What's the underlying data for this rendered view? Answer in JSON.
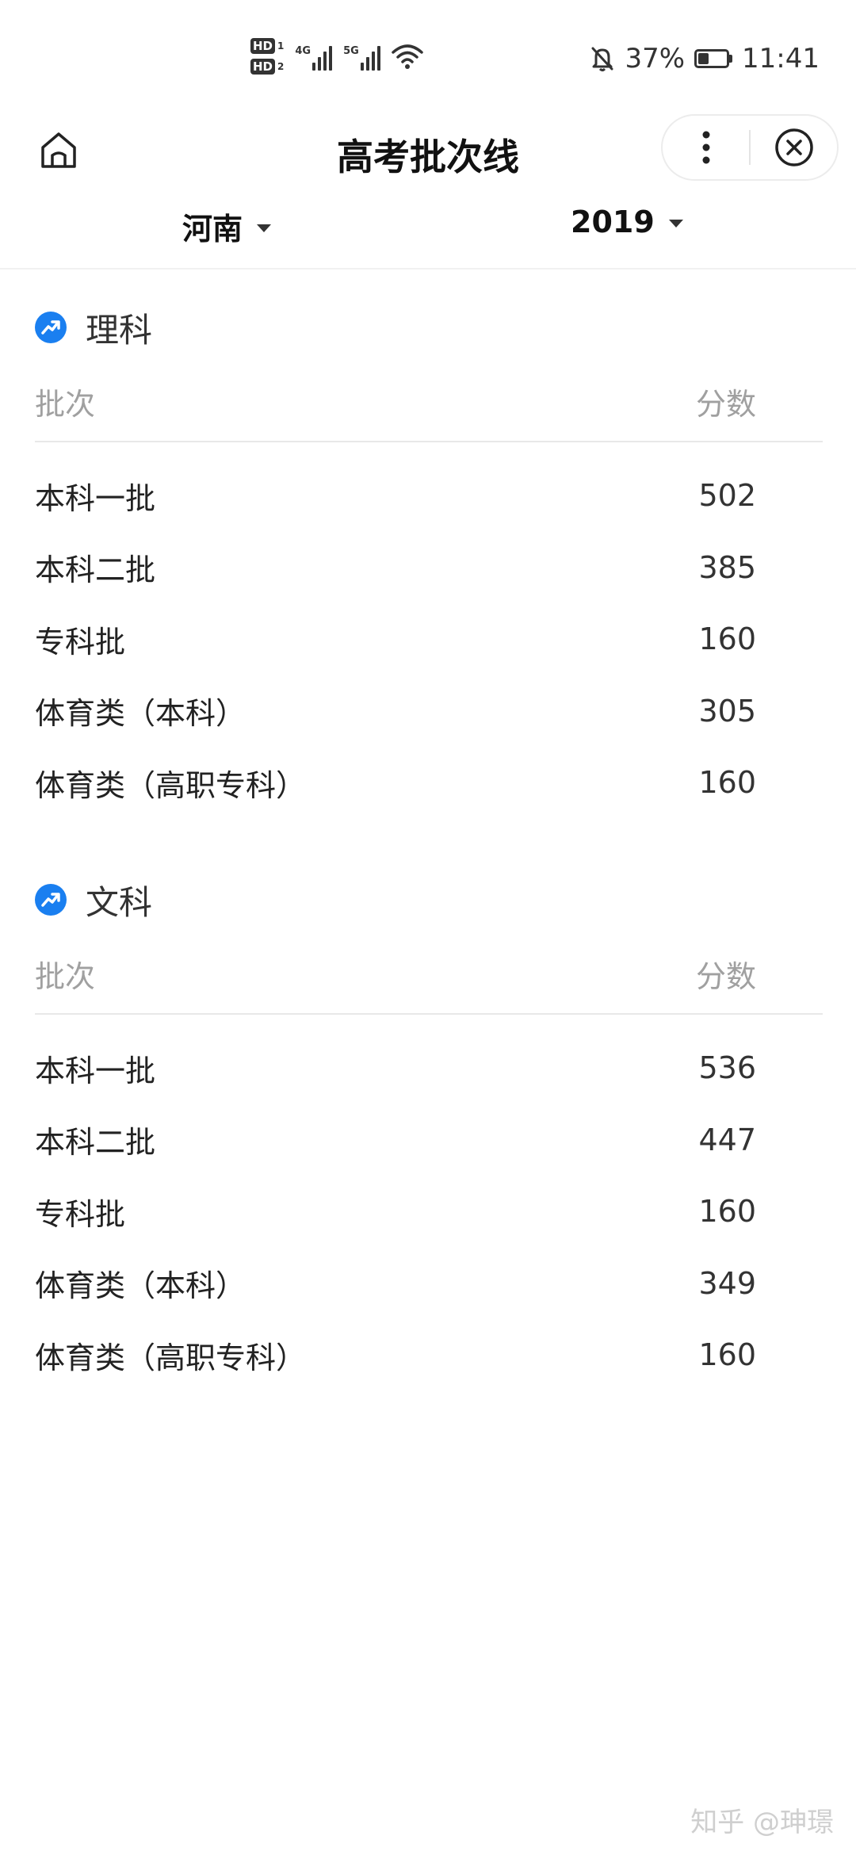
{
  "status_bar": {
    "hd_badges": [
      {
        "label": "HD",
        "slot": "1"
      },
      {
        "label": "HD",
        "slot": "2"
      }
    ],
    "network_1": "4G",
    "network_2": "5G",
    "signal_icon": "signal-bars-icon",
    "wifi_icon": "wifi-icon",
    "mute_icon": "bell-off-icon",
    "battery_percent": "37%",
    "battery_level": 0.37,
    "time": "11:41"
  },
  "title_bar": {
    "title": "高考批次线",
    "home_icon": "home-icon",
    "more_icon": "more-vertical-icon",
    "close_icon": "close-circle-icon"
  },
  "filters": {
    "province": "河南",
    "year": "2019"
  },
  "sections": [
    {
      "title": "理科",
      "icon": "trend-up-icon",
      "col_batch": "批次",
      "col_score": "分数",
      "rows": [
        {
          "batch": "本科一批",
          "score": "502"
        },
        {
          "batch": "本科二批",
          "score": "385"
        },
        {
          "batch": "专科批",
          "score": "160"
        },
        {
          "batch": "体育类（本科）",
          "score": "305"
        },
        {
          "batch": "体育类（高职专科）",
          "score": "160"
        }
      ]
    },
    {
      "title": "文科",
      "icon": "trend-up-icon",
      "col_batch": "批次",
      "col_score": "分数",
      "rows": [
        {
          "batch": "本科一批",
          "score": "536"
        },
        {
          "batch": "本科二批",
          "score": "447"
        },
        {
          "batch": "专科批",
          "score": "160"
        },
        {
          "batch": "体育类（本科）",
          "score": "349"
        },
        {
          "batch": "体育类（高职专科）",
          "score": "160"
        }
      ]
    }
  ],
  "watermark": "知乎 @珅璟",
  "colors": {
    "accent": "#1a7ff0",
    "text": "#222222",
    "muted": "#a0a0a0",
    "divider": "#e8e8e8"
  }
}
